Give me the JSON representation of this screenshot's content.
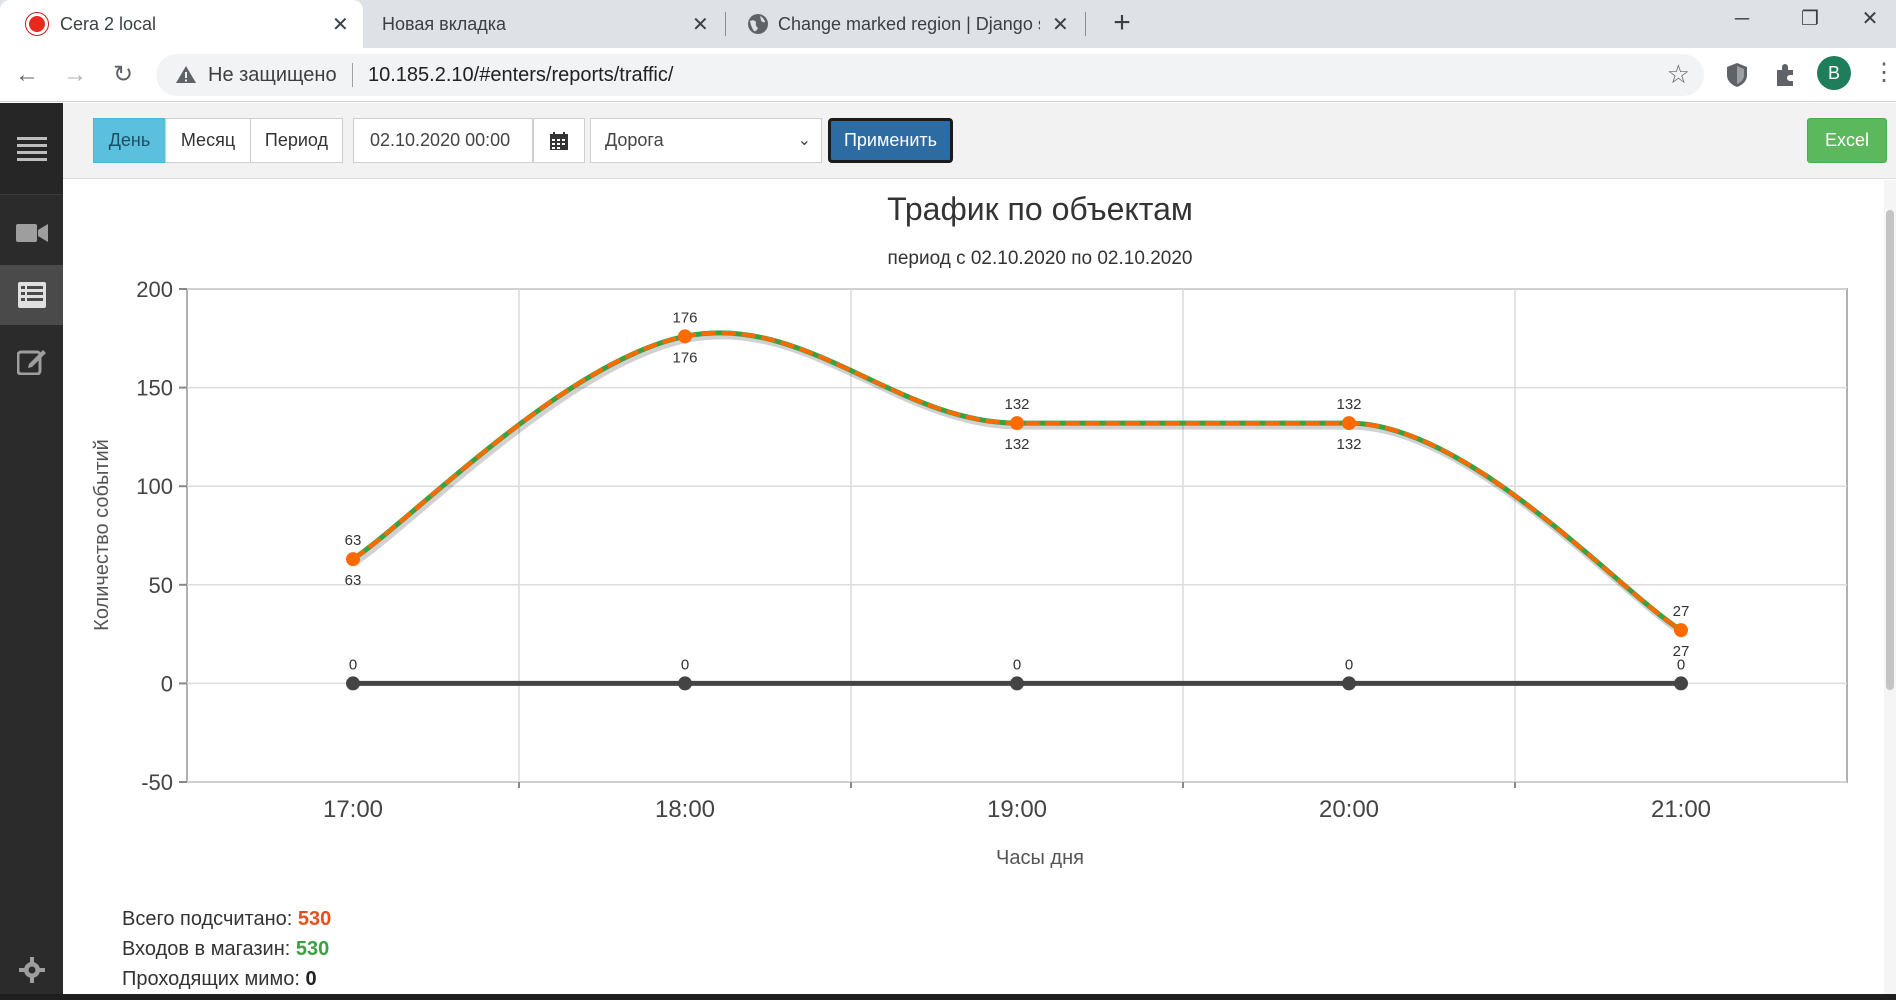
{
  "browser": {
    "tabs": [
      {
        "title": "Cera 2 local",
        "active": true
      },
      {
        "title": "Новая вкладка",
        "active": false
      },
      {
        "title": "Change marked region | Django s",
        "active": false
      }
    ],
    "security_label": "Не защищено",
    "url": "10.185.2.10/#enters/reports/traffic/",
    "profile_initial": "B"
  },
  "toolbar": {
    "period_buttons": [
      "День",
      "Месяц",
      "Период"
    ],
    "active_period": "День",
    "date_value": "02.10.2020 00:00",
    "select_value": "Дорога",
    "apply_label": "Применить",
    "excel_label": "Excel"
  },
  "colors": {
    "orange": "#ff6a00",
    "green": "#3aa042",
    "dark": "#444444",
    "active_btn": "#5bc0de",
    "apply_btn": "#2d6ca2"
  },
  "chart_data": {
    "type": "line",
    "title": "Трафик по объектам",
    "subtitle": "период с 02.10.2020 по 02.10.2020",
    "xlabel": "Часы дня",
    "ylabel": "Количество событий",
    "categories": [
      "17:00",
      "18:00",
      "19:00",
      "20:00",
      "21:00"
    ],
    "ylim": [
      -50,
      200
    ],
    "yticks": [
      200,
      150,
      100,
      50,
      0,
      -50
    ],
    "grid": true,
    "series": [
      {
        "values": [
          63,
          176,
          132,
          132,
          27
        ],
        "color": "#3aa042",
        "style": "solid",
        "label_position": "below"
      },
      {
        "values": [
          63,
          176,
          132,
          132,
          27
        ],
        "color": "#ff6a00",
        "style": "dashed",
        "label_position": "above"
      },
      {
        "values": [
          0,
          0,
          0,
          0,
          0
        ],
        "color": "#444444",
        "style": "solid",
        "label_position": "above"
      }
    ]
  },
  "summary": {
    "total_label": "Всего подсчитано:",
    "total_value": "530",
    "in_label": "Входов в магазин:",
    "in_value": "530",
    "pass_label": "Проходящих мимо:",
    "pass_value": "0"
  }
}
